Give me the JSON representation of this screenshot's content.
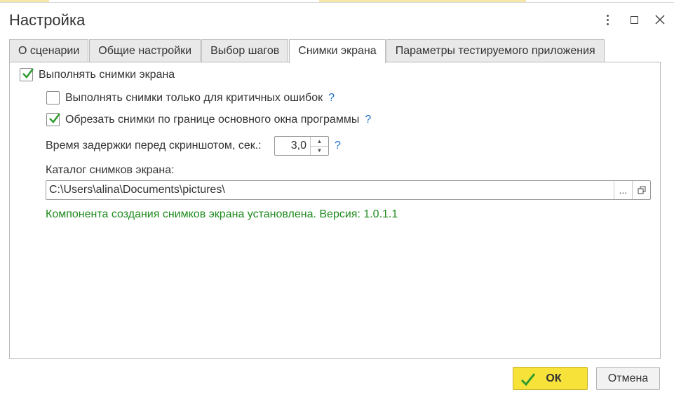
{
  "window": {
    "title": "Настройка",
    "controls": [
      "more-icon",
      "maximize-icon",
      "close-icon"
    ]
  },
  "tabs": [
    {
      "label": "О сценарии",
      "active": false
    },
    {
      "label": "Общие настройки",
      "active": false
    },
    {
      "label": "Выбор шагов",
      "active": false
    },
    {
      "label": "Снимки экрана",
      "active": true
    },
    {
      "label": "Параметры тестируемого приложения",
      "active": false
    }
  ],
  "screenshots": {
    "take_screenshots": {
      "label": "Выполнять снимки экрана",
      "checked": true
    },
    "critical_only": {
      "label": "Выполнять снимки только для критичных ошибок",
      "checked": false,
      "help": "?"
    },
    "crop_to_window": {
      "label": "Обрезать снимки по границе основного окна программы",
      "checked": true,
      "help": "?"
    },
    "delay": {
      "label": "Время задержки перед скриншотом, сек.:",
      "value": "3,0",
      "help": "?"
    },
    "folder": {
      "label": "Каталог снимков экрана:",
      "value": "C:\\Users\\alina\\Documents\\pictures\\",
      "browse": "..."
    },
    "status": "Компонента создания снимков экрана установлена. Версия: 1.0.1.1"
  },
  "footer": {
    "ok_label": "ОК",
    "cancel_label": "Отмена"
  },
  "colors": {
    "accent_ok": "#f7e23a",
    "status_green": "#1f8a1f",
    "help_blue": "#1a6fc7",
    "check_green": "#2e9b2e"
  }
}
